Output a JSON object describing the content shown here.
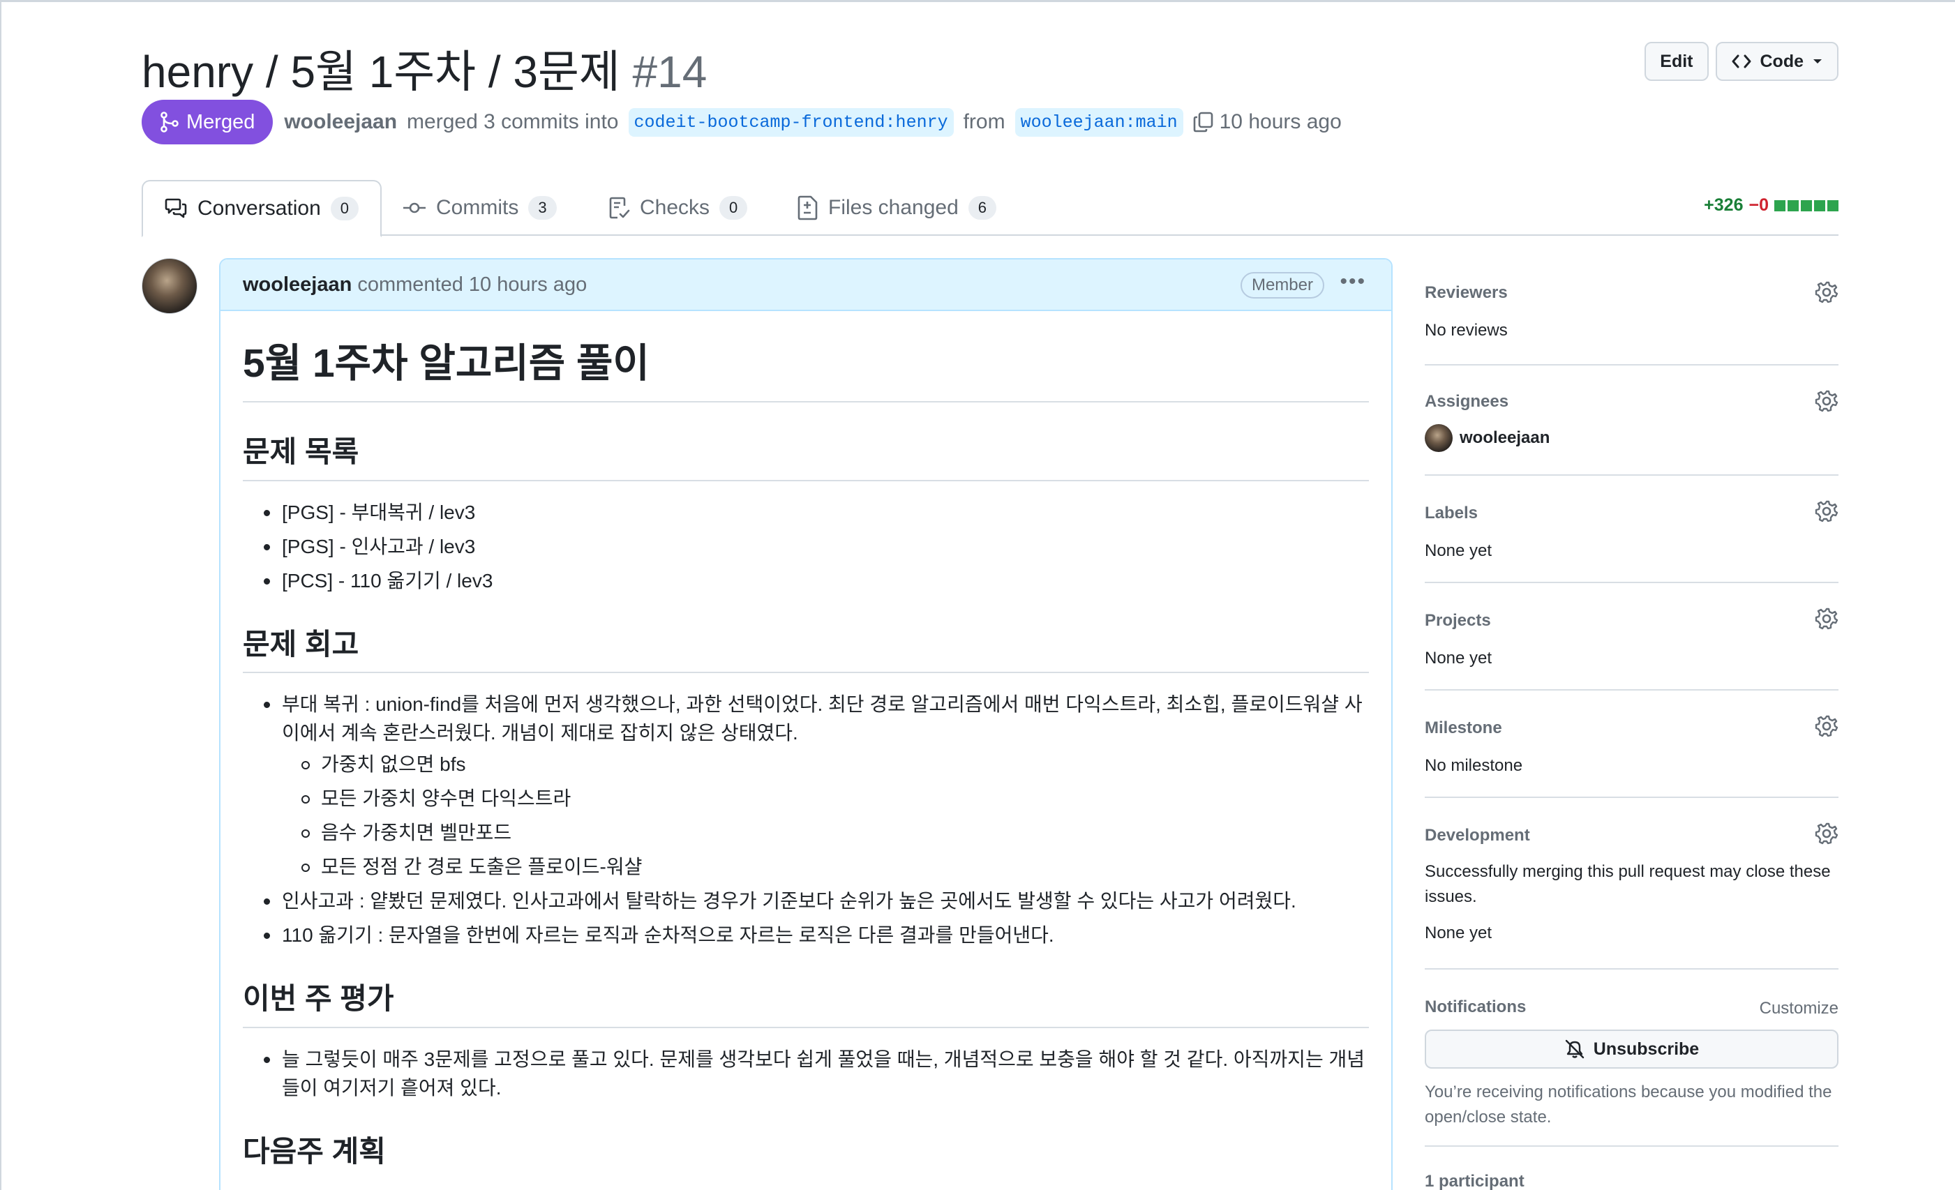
{
  "header": {
    "title": "henry / 5월 1주차 / 3문제",
    "number": "#14",
    "edit_label": "Edit",
    "code_label": "Code"
  },
  "meta": {
    "status": "Merged",
    "author": "wooleejaan",
    "action": "merged 3 commits into",
    "base_branch": "codeit-bootcamp-frontend:henry",
    "from_word": "from",
    "head_branch": "wooleejaan:main",
    "time": "10 hours ago"
  },
  "tabs": [
    {
      "label": "Conversation",
      "count": "0"
    },
    {
      "label": "Commits",
      "count": "3"
    },
    {
      "label": "Checks",
      "count": "0"
    },
    {
      "label": "Files changed",
      "count": "6"
    }
  ],
  "diffstat": {
    "additions": "+326",
    "deletions": "−0"
  },
  "comment": {
    "author": "wooleejaan",
    "action": "commented 10 hours ago",
    "badge": "Member",
    "h1": "5월 1주차 알고리즘 풀이",
    "sections": [
      {
        "heading": "문제 목록"
      },
      {
        "heading": "문제 회고"
      },
      {
        "heading": "이번 주 평가"
      },
      {
        "heading": "다음주 계획"
      }
    ],
    "problems": [
      "[PGS] - 부대복귀 / lev3",
      "[PGS] - 인사고과 / lev3",
      "[PCS] - 110 옮기기 / lev3"
    ],
    "retro": {
      "item1": "부대 복귀 : union-find를 처음에 먼저 생각했으나, 과한 선택이었다. 최단 경로 알고리즘에서 매번 다익스트라, 최소힙, 플로이드워샬 사이에서 계속 혼란스러웠다. 개념이 제대로 잡히지 않은 상태였다.",
      "subitems": [
        "가중치 없으면 bfs",
        "모든 가중치 양수면 다익스트라",
        "음수 가중치면 벨만포드",
        "모든 정점 간 경로 도출은 플로이드-워샬"
      ],
      "item2": "인사고과 : 얕봤던 문제였다. 인사고과에서 탈락하는 경우가 기준보다 순위가 높은 곳에서도 발생할 수 있다는 사고가 어려웠다.",
      "item3": "110 옮기기 : 문자열을 한번에 자르는 로직과 순차적으로 자르는 로직은 다른 결과를 만들어낸다."
    },
    "evaluation": "늘 그렇듯이 매주 3문제를 고정으로 풀고 있다. 문제를 생각보다 쉽게 풀었을 때는, 개념적으로 보충을 해야 할 것 같다. 아직까지는 개념들이 여기저기 흩어져 있다."
  },
  "sidebar": {
    "reviewers": {
      "title": "Reviewers",
      "value": "No reviews"
    },
    "assignees": {
      "title": "Assignees",
      "value": "wooleejaan"
    },
    "labels": {
      "title": "Labels",
      "value": "None yet"
    },
    "projects": {
      "title": "Projects",
      "value": "None yet"
    },
    "milestone": {
      "title": "Milestone",
      "value": "No milestone"
    },
    "development": {
      "title": "Development",
      "note": "Successfully merging this pull request may close these issues.",
      "value": "None yet"
    },
    "notifications": {
      "title": "Notifications",
      "customize": "Customize",
      "button": "Unsubscribe",
      "note": "You’re receiving notifications because you modified the open/close state."
    },
    "participants": {
      "title": "1 participant"
    }
  }
}
